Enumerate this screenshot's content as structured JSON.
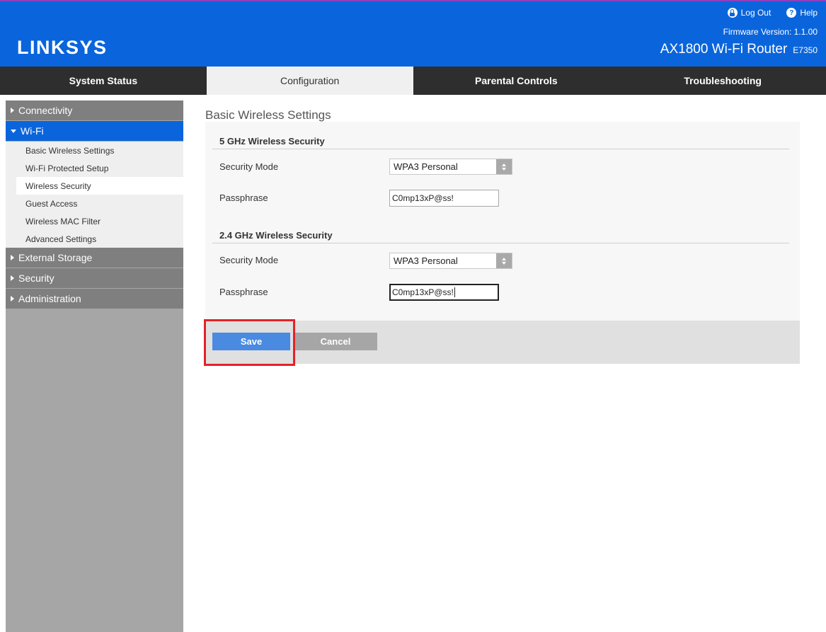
{
  "header": {
    "logo": "LINKSYS",
    "logout_label": "Log Out",
    "help_label": "Help",
    "firmware": "Firmware Version: 1.1.00",
    "model_name": "AX1800 Wi-Fi Router",
    "model_code": "E7350",
    "colors": {
      "brand_blue": "#0a65dc",
      "top_stripe": "#8e3fbf"
    }
  },
  "nav": {
    "tabs": [
      {
        "label": "System Status"
      },
      {
        "label": "Configuration",
        "active": true
      },
      {
        "label": "Parental Controls"
      },
      {
        "label": "Troubleshooting"
      }
    ]
  },
  "sidebar": {
    "groups": [
      {
        "label": "Connectivity"
      },
      {
        "label": "Wi-Fi",
        "expanded": true,
        "items": [
          {
            "label": "Basic Wireless Settings"
          },
          {
            "label": "Wi-Fi Protected Setup"
          },
          {
            "label": "Wireless Security",
            "active": true
          },
          {
            "label": "Guest Access"
          },
          {
            "label": "Wireless MAC Filter"
          },
          {
            "label": "Advanced Settings"
          }
        ]
      },
      {
        "label": "External Storage"
      },
      {
        "label": "Security"
      },
      {
        "label": "Administration"
      }
    ]
  },
  "main": {
    "page_title": "Basic Wireless Settings",
    "sections": [
      {
        "title": "5 GHz Wireless Security",
        "security_mode_label": "Security Mode",
        "security_mode_value": "WPA3 Personal",
        "passphrase_label": "Passphrase",
        "passphrase_value": "C0mp13xP@ss!"
      },
      {
        "title": "2.4 GHz Wireless Security",
        "security_mode_label": "Security Mode",
        "security_mode_value": "WPA3 Personal",
        "passphrase_label": "Passphrase",
        "passphrase_value": "C0mp13xP@ss!"
      }
    ],
    "save_label": "Save",
    "cancel_label": "Cancel"
  }
}
